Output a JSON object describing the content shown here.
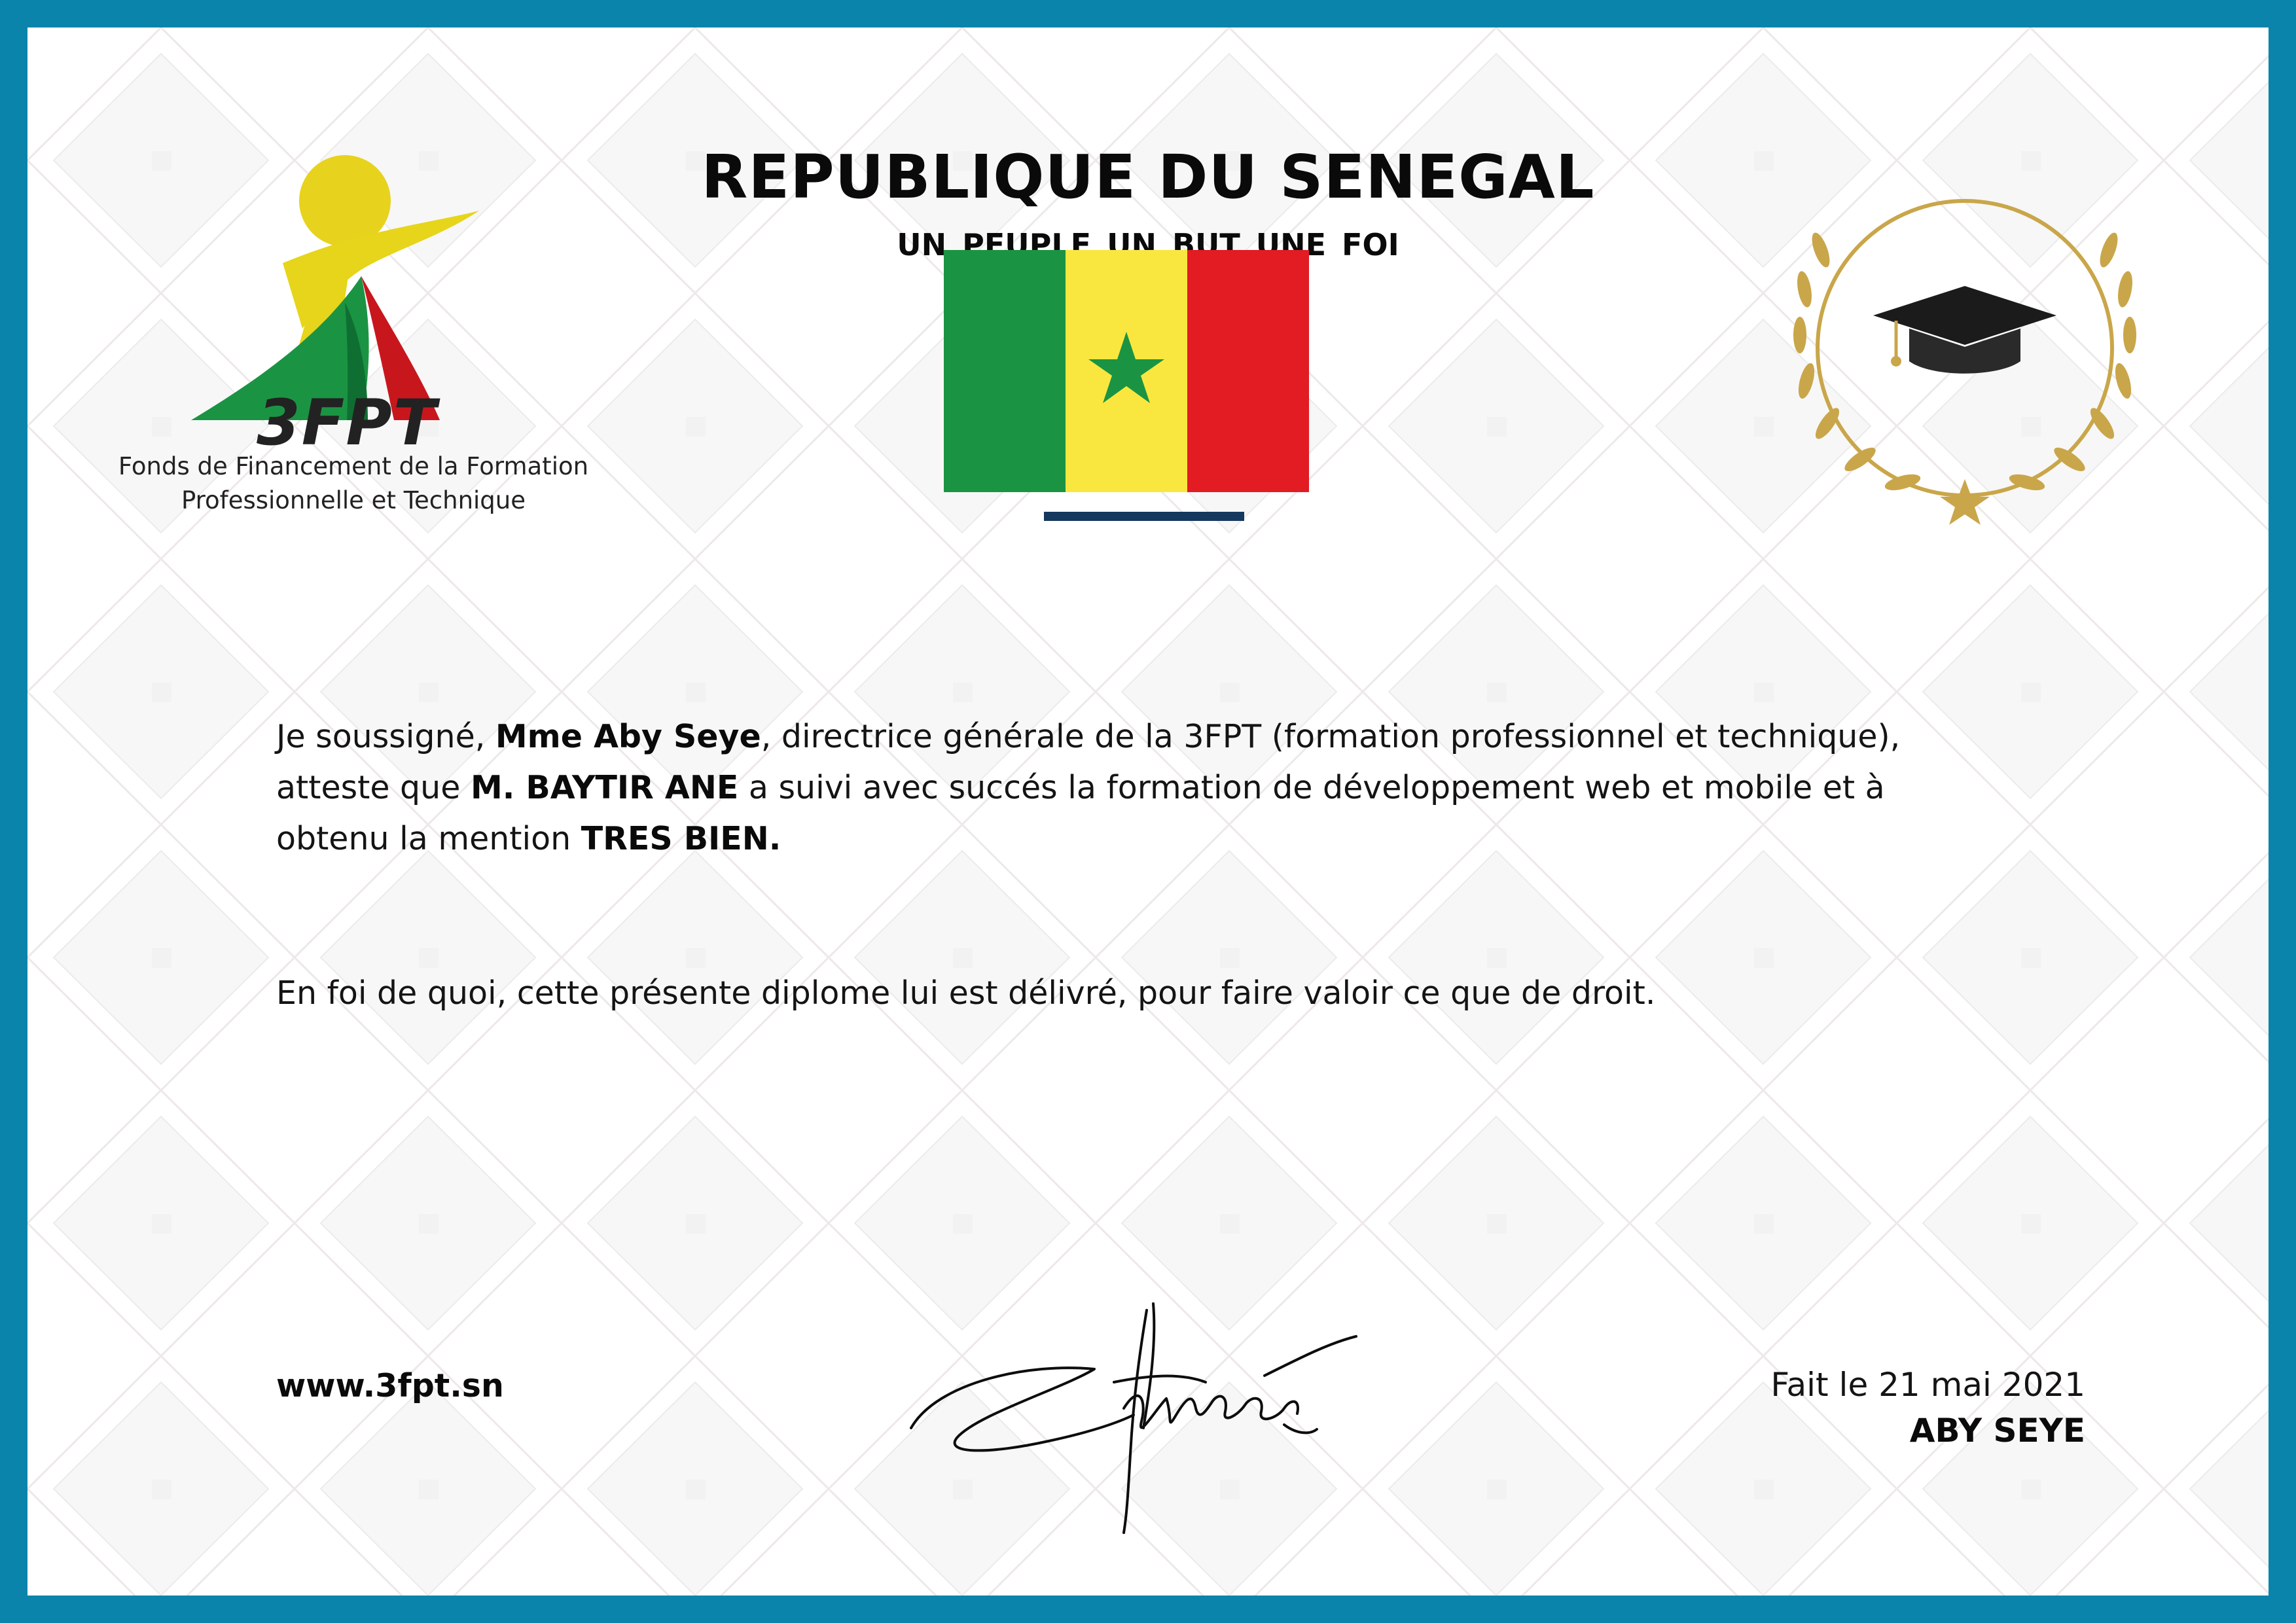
{
  "header": {
    "title": "REPUBLIQUE DU SENEGAL",
    "motto": "UN PEUPLE  UN BUT  UNE FOI"
  },
  "logo": {
    "mark": "3FPT",
    "name_line1": "Fonds de Financement de la Formation",
    "name_line2": "Professionnelle et Technique"
  },
  "flag": {
    "colors": [
      "#1a9443",
      "#f9e740",
      "#e31b23"
    ],
    "star_color": "#1a9443"
  },
  "emblem": {
    "icon": "graduation-cap-laurel-icon",
    "ring_color": "#c9a64a"
  },
  "body": {
    "p1_a": "Je soussigné, ",
    "p1_name": "Mme Aby Seye",
    "p1_b": ", directrice générale de la 3FPT (formation professionnel et technique),",
    "p1_c": "atteste que ",
    "p1_student": "M. BAYTIR ANE",
    "p1_d": " a suivi avec succés la formation de développement web et mobile et à",
    "p1_e": "obtenu la mention ",
    "p1_mention": "TRES BIEN.",
    "p2": "En foi de quoi, cette présente diplome lui est délivré, pour faire valoir ce que de droit."
  },
  "footer": {
    "website": "www.3fpt.sn",
    "date": "Fait le 21 mai 2021",
    "signer": "ABY SEYE"
  },
  "colors": {
    "border": "#0b84ab",
    "underline": "#15385e"
  }
}
